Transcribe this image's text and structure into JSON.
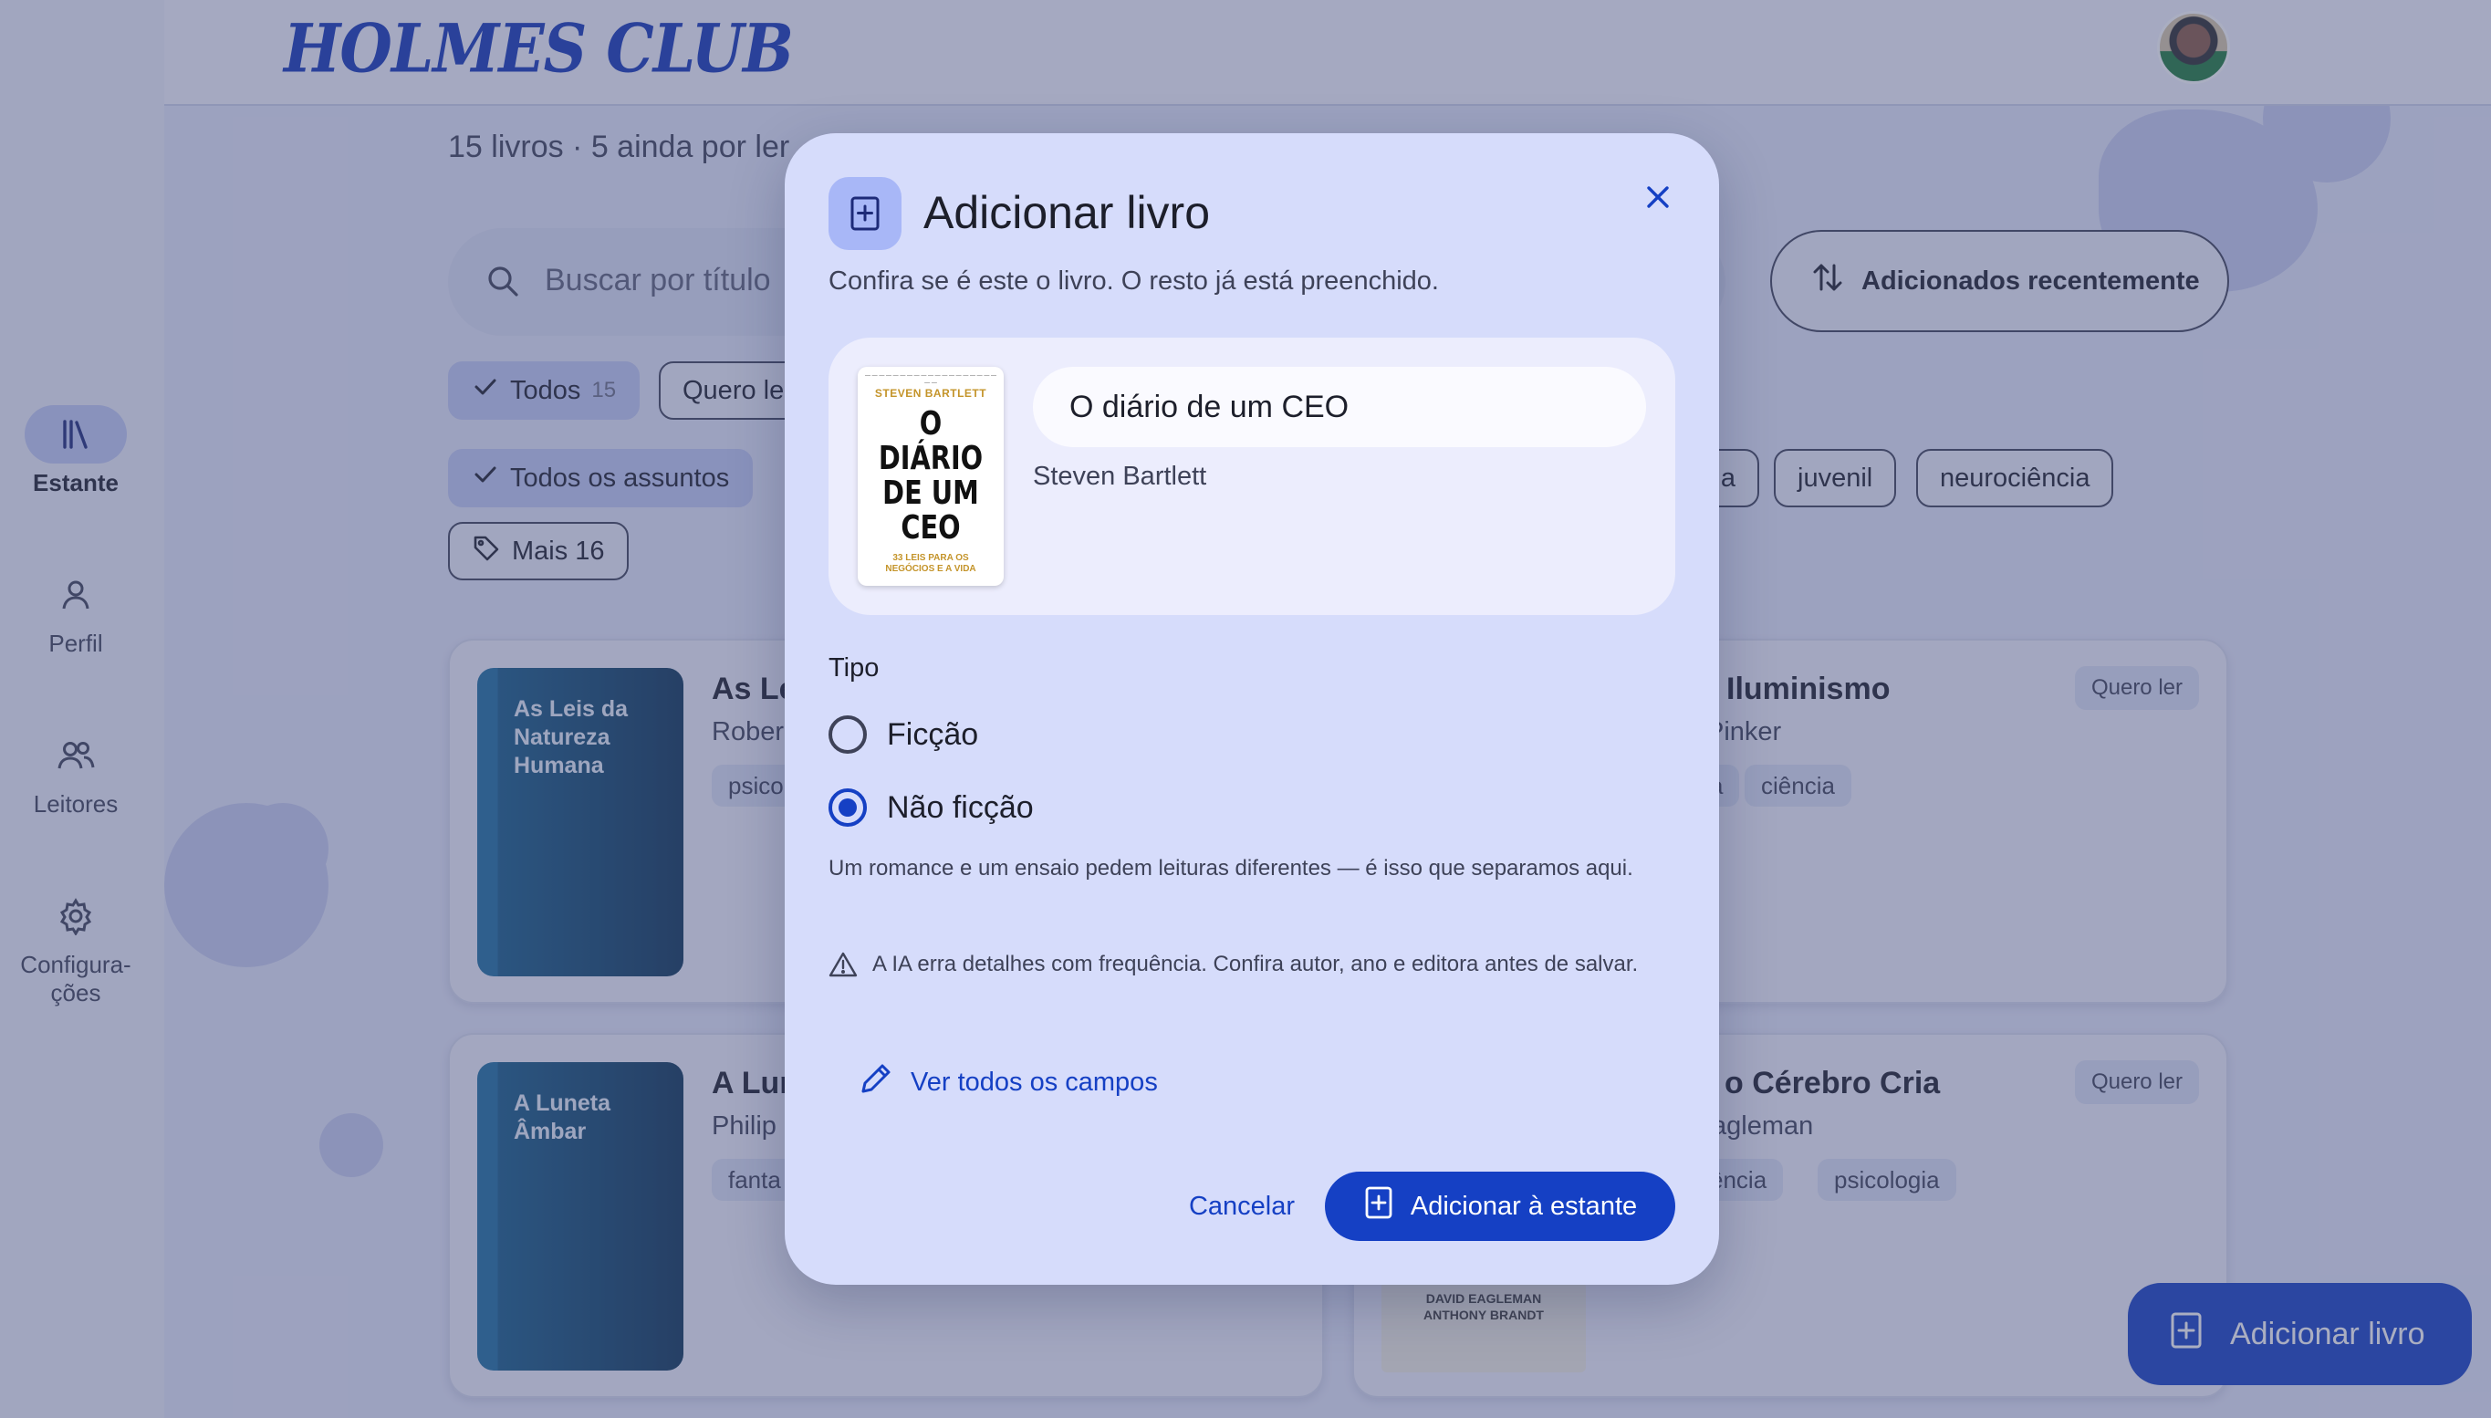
{
  "app": {
    "brand": "HOLMES CLUB"
  },
  "nav": {
    "items": [
      {
        "label": "Estante",
        "icon": "books-icon",
        "active": true
      },
      {
        "label": "Perfil",
        "icon": "person-icon",
        "active": false
      },
      {
        "label": "Leitores",
        "icon": "people-icon",
        "active": false
      },
      {
        "label": "Configura-\nções",
        "icon": "gear-icon",
        "active": false
      }
    ]
  },
  "library": {
    "summary": "15 livros · 5 ainda por ler",
    "search_placeholder": "Buscar por título",
    "sort_label": "Adicionados recentemente",
    "status_filters": [
      {
        "label": "Todos",
        "count": "15",
        "selected": true
      },
      {
        "label": "Quero ler",
        "selected": false
      }
    ],
    "subject_filters": [
      {
        "label": "Todos os assuntos",
        "selected": true
      },
      {
        "label": "a",
        "selected": false
      },
      {
        "label": "juvenil",
        "selected": false
      },
      {
        "label": "neurociência",
        "selected": false
      }
    ],
    "more_label": "Mais 16",
    "books": [
      {
        "cover_text": "As Leis da Natureza Humana",
        "title": "As Le",
        "author": "Rober",
        "tags": [
          "psico"
        ]
      },
      {
        "title": "Iluminismo",
        "author": "Pinker",
        "tags": [
          "a",
          "ciência"
        ],
        "status": "Quero ler"
      },
      {
        "cover_text": "A Luneta Âmbar",
        "title": "A Lun",
        "author": "Philip",
        "tags": [
          "fanta"
        ]
      },
      {
        "title": "o Cérebro Cria",
        "author": "agleman",
        "tags": [
          "ência",
          "psicologia"
        ],
        "status": "Quero ler",
        "cover_text": "DAVID EAGLEMAN\nANTHONY BRANDT"
      }
    ]
  },
  "fab": {
    "label": "Adicionar livro"
  },
  "dialog": {
    "title": "Adicionar livro",
    "subtitle": "Confira se é este o livro. O resto já está preenchido.",
    "book": {
      "title_value": "O diário de um CEO",
      "author": "Steven Bartlett",
      "cover": {
        "author": "STEVEN BARTLETT",
        "title": "O DIÁRIO DE UM CEO",
        "subtitle": "33 LEIS PARA OS NEGÓCIOS E A VIDA"
      }
    },
    "type_label": "Tipo",
    "type_options": [
      {
        "label": "Ficção",
        "checked": false
      },
      {
        "label": "Não ficção",
        "checked": true
      }
    ],
    "helper_text": "Um romance e um ensaio pedem leituras diferentes — é isso que separamos aqui.",
    "warning_text": "A IA erra detalhes com frequência. Confira autor, ano e editora antes de salvar.",
    "view_fields_label": "Ver todos os campos",
    "cancel_label": "Cancelar",
    "confirm_label": "Adicionar à estante"
  },
  "colors": {
    "primary": "#1540c4",
    "dialog_bg": "#d6dcfb",
    "chip_selected": "#c3cbf6"
  }
}
